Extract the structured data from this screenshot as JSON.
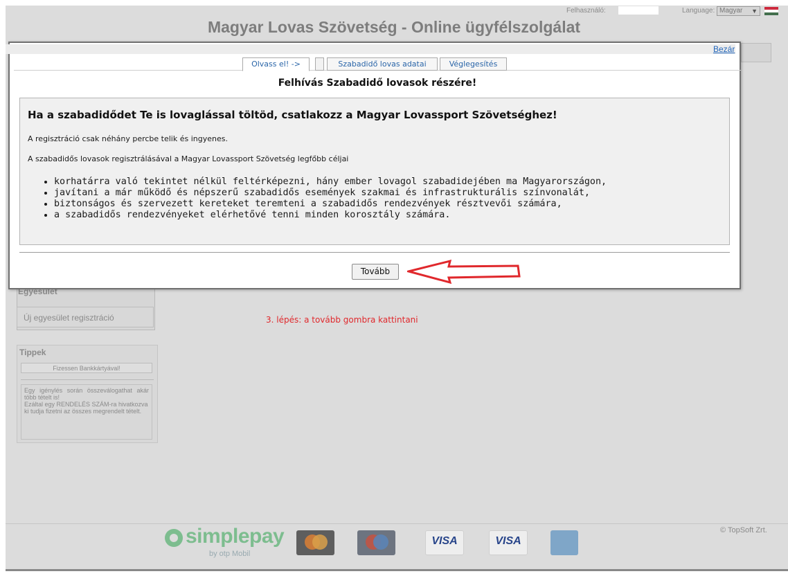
{
  "header": {
    "title": "Magyar Lovas Szövetség - Online ügyfélszolgálat",
    "user_label": "Felhasználó:",
    "language_label": "Language:",
    "language_value": "Magyar"
  },
  "sidebar": {
    "section_title": "Egyesület",
    "item_new_club": "Új egyesület regisztráció",
    "tips_title": "Tippek",
    "tips_button": "Fizessen Bankkártyával!",
    "tips_text_1": "Egy igénylés során összeválogathat akár több tételt is!",
    "tips_text_2": "Ezáltal egy RENDELÉS SZÁM-ra hivatkozva ki tudja fizetni az összes megrendelt tételt."
  },
  "annotation": "3. lépés: a tovább gombra kattintani",
  "footer": {
    "copyright": "© TopSoft Zrt.",
    "simplepay": "simplepay",
    "simplepay_by": "by otp Mobil",
    "visa": "VISA"
  },
  "modal": {
    "close_label": "Bezár",
    "tabs": [
      {
        "label": "Olvass el! ->",
        "active": true
      },
      {
        "label": "Szabadidő lovas adatai",
        "active": false
      },
      {
        "label": "Véglegesítés",
        "active": false
      }
    ],
    "heading": "Felhívás Szabadidő lovasok részére!",
    "content": {
      "title": "Ha a szabadidődet Te is lovaglással töltöd, csatlakozz a Magyar Lovassport Szövetséghez!",
      "para1": "A regisztráció csak néhány percbe telik és ingyenes.",
      "para2": "A szabadidős lovasok regisztrálásával a Magyar Lovassport Szövetség legfőbb céljai",
      "goals": [
        "korhatárra való tekintet nélkül feltérképezni, hány ember lovagol szabadidejében ma Magyarországon,",
        "javítani a már működő és népszerű szabadidős események szakmai és infrastrukturális színvonalát,",
        "biztonságos és szervezett kereteket teremteni a szabadidős rendezvények résztvevői számára,",
        "a szabadidős rendezvényeket elérhetővé tenni minden korosztály számára."
      ]
    },
    "next_button": "Tovább"
  },
  "colors": {
    "annotation_red": "#e0282c",
    "link_blue": "#2266bb",
    "overlay_gray": "#dcdcdc"
  }
}
